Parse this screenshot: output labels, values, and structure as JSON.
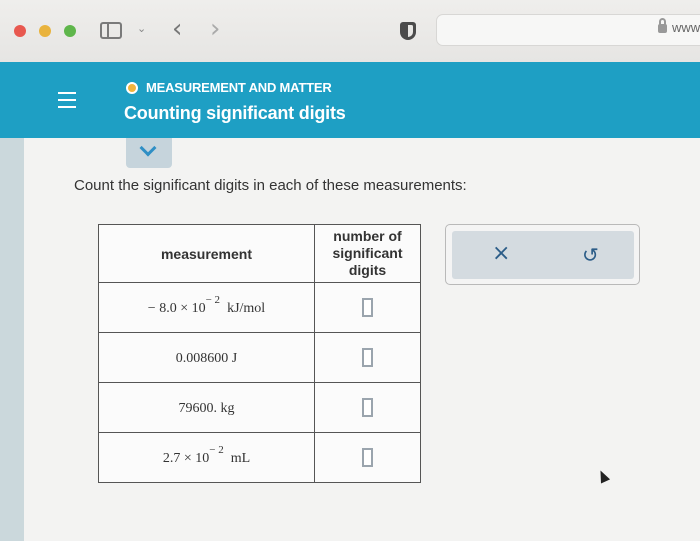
{
  "browser": {
    "url_text": "www"
  },
  "header": {
    "topic": "MEASUREMENT AND MATTER",
    "lesson": "Counting significant digits",
    "accent_color": "#1e9fc4",
    "topic_dot_color": "#f1b43c"
  },
  "main": {
    "prompt": "Count the significant digits in each of these measurements:"
  },
  "table": {
    "headers": [
      "measurement",
      "number of significant digits"
    ],
    "rows": [
      {
        "mantissa": "− 8.0 × 10",
        "exponent": "− 2",
        "unit": "kJ/mol",
        "answer": ""
      },
      {
        "value": "0.008600 J",
        "answer": ""
      },
      {
        "value": "79600. kg",
        "answer": ""
      },
      {
        "mantissa": "2.7 × 10",
        "exponent": "− 2",
        "unit": "mL",
        "answer": ""
      }
    ]
  },
  "actions": {
    "clear_icon": "×",
    "undo_icon": "↺"
  }
}
